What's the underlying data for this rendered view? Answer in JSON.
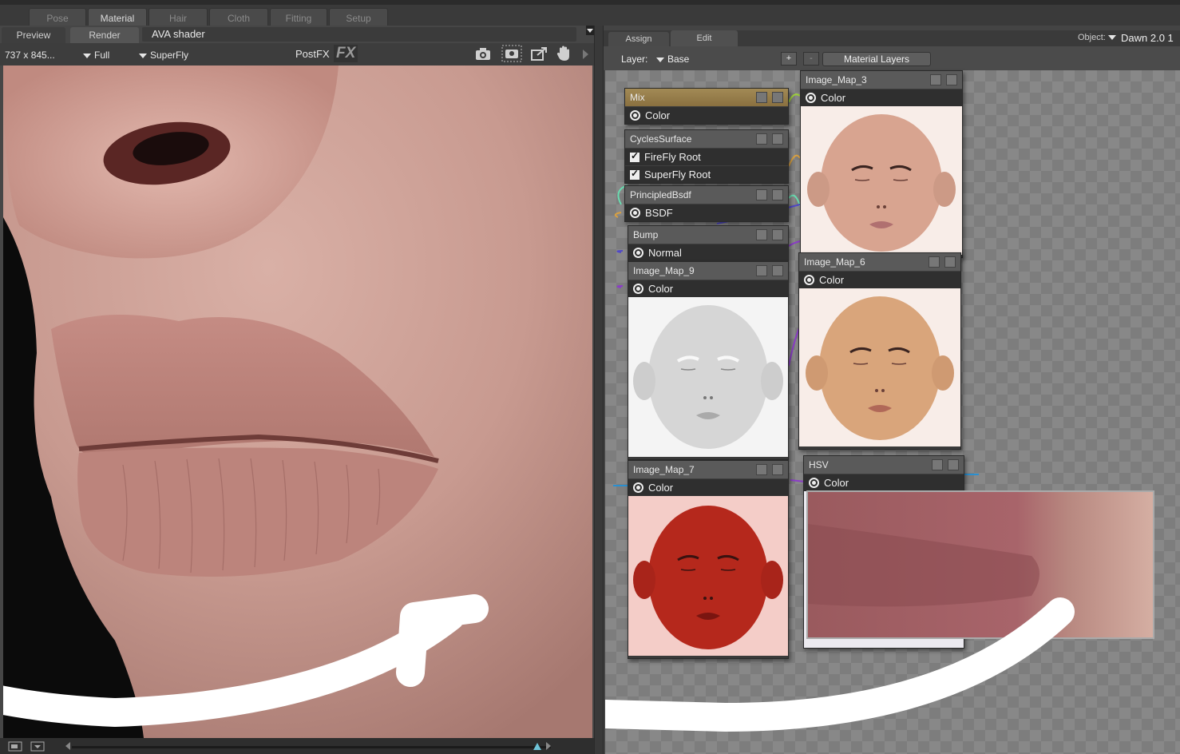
{
  "top_tabs": [
    "Pose",
    "Material",
    "Hair",
    "Cloth",
    "Fitting",
    "Setup"
  ],
  "left": {
    "tabs": [
      "Preview",
      "Render"
    ],
    "shader_name": "AVA shader",
    "resolution": "737 x 845...",
    "quality": "Full",
    "engine": "SuperFly",
    "postfx_label": "PostFX",
    "fx_label": "FX"
  },
  "right": {
    "tabs": [
      "Assign",
      "Edit"
    ],
    "object_label": "Object:",
    "object_value": "Dawn 2.0 1",
    "layer_label": "Layer:",
    "layer_value": "Base",
    "add_label": "+",
    "remove_label": "-",
    "material_layers_label": "Material Layers"
  },
  "nodes": {
    "mix": {
      "title": "Mix",
      "output": "Color"
    },
    "cycles": {
      "title": "CyclesSurface",
      "out1": "FireFly Root",
      "out2": "SuperFly Root"
    },
    "principled": {
      "title": "PrincipledBsdf",
      "output": "BSDF"
    },
    "bump": {
      "title": "Bump",
      "output": "Normal"
    },
    "map9": {
      "title": "Image_Map_9",
      "output": "Color"
    },
    "map7": {
      "title": "Image_Map_7",
      "output": "Color"
    },
    "map3": {
      "title": "Image_Map_3",
      "output": "Color"
    },
    "map6": {
      "title": "Image_Map_6",
      "output": "Color"
    },
    "hsv": {
      "title": "HSV",
      "output": "Color"
    }
  },
  "colors": {
    "accent_gold": "#a28a55",
    "skin": "#c89c92",
    "face_tan": "#d9a57b",
    "face_red": "#b5281c"
  }
}
